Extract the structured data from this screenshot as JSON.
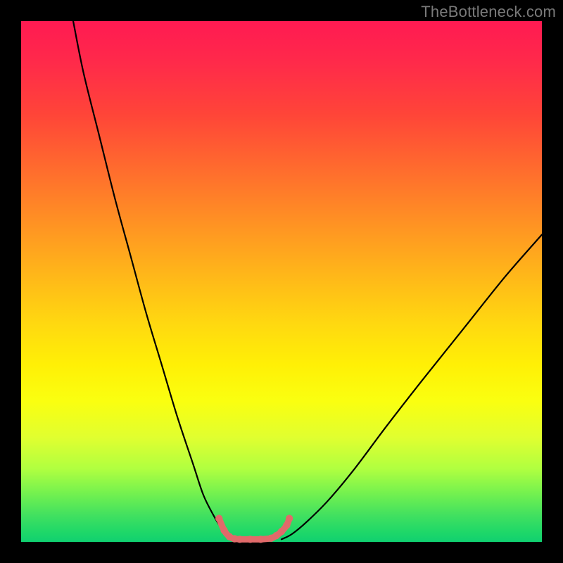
{
  "watermark": "TheBottleneck.com",
  "chart_data": {
    "type": "line",
    "title": "",
    "xlabel": "",
    "ylabel": "",
    "xlim": [
      0,
      100
    ],
    "ylim": [
      0,
      100
    ],
    "grid": false,
    "legend": false,
    "series": [
      {
        "name": "left-curve",
        "color": "#000000",
        "x": [
          10,
          12,
          15,
          18,
          21,
          24,
          27,
          30,
          33,
          35,
          37,
          38.5,
          39.5,
          40
        ],
        "y": [
          100,
          90,
          78,
          66,
          55,
          44,
          34,
          24,
          15,
          9,
          5,
          2.5,
          1,
          0.5
        ]
      },
      {
        "name": "bottom-knot",
        "color": "#e16a6a",
        "x": [
          38,
          39,
          40,
          41,
          42,
          44,
          46,
          48,
          49,
          50,
          51,
          51.5
        ],
        "y": [
          4.5,
          2.2,
          1.0,
          0.6,
          0.5,
          0.5,
          0.5,
          0.7,
          1.2,
          2.0,
          3.2,
          4.5
        ]
      },
      {
        "name": "right-curve",
        "color": "#000000",
        "x": [
          50,
          52,
          55,
          59,
          64,
          70,
          77,
          85,
          93,
          100
        ],
        "y": [
          0.5,
          1.5,
          4,
          8,
          14,
          22,
          31,
          41,
          51,
          59
        ]
      }
    ],
    "background_gradient": {
      "top": "#ff1a52",
      "mid": "#fff006",
      "bottom": "#10d070"
    }
  }
}
